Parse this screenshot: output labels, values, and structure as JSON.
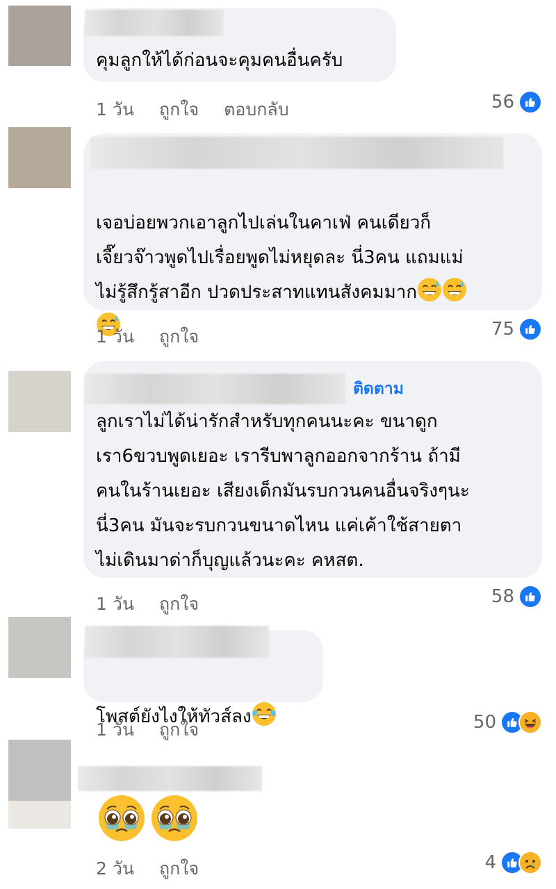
{
  "comments": [
    {
      "text": "คุมลูกให้ได้ก่อนจะคุมคนอื่นครับ",
      "time": "1 วัน",
      "like": "ถูกใจ",
      "reply": "ตอบกลับ",
      "count": "56"
    },
    {
      "text": "เจอบ่อยพวกเอาลูกไปเล่นในคาเฟ่ คนเดียวก็\nเจี๊ยวจ๊าวพูดไปเรื่อยพูดไม่หยุดละ นี่3คน แถมแม่\nไม่รู้สึกรู้สาอีก ปวดประสาทแทนสังคมมาก",
      "time": "1 วัน",
      "like": "ถูกใจ",
      "count": "75"
    },
    {
      "follow": "ติดตาม",
      "text": "ลูกเราไม่ได้น่ารักสำหรับทุกคนนะคะ ขนาดูก\nเรา6ขวบพูดเยอะ เรารีบพาลูกออกจากร้าน ถ้ามี\nคนในร้านเยอะ เสียงเด็กมันรบกวนคนอื่นจริงๆนะ\nนี่3คน มันจะรบกวนขนาดไหน แค่เค้าใช้สายตา\nไม่เดินมาด่าก็บุญแล้วนะคะ คหสต.",
      "time": "1 วัน",
      "like": "ถูกใจ",
      "count": "58"
    },
    {
      "text": "โพสต์ยังไงให้ทัวส์ลง",
      "time": "1 วัน",
      "like": "ถูกใจ",
      "count": "50"
    },
    {
      "time": "2 วัน",
      "like": "ถูกใจ",
      "count": "4"
    }
  ],
  "icons": {
    "like": "thumbs-up-icon",
    "haha": "laughing-emoji-icon",
    "sad": "sad-emoji-icon",
    "sweat": "grinning-sweat-emoji-icon",
    "tears": "tears-of-joy-emoji-icon",
    "pleading": "pleading-face-emoji-icon"
  },
  "colors": {
    "bubble": "#f0f2f5",
    "link": "#1877f2",
    "meta": "#65676b",
    "text": "#050505"
  }
}
